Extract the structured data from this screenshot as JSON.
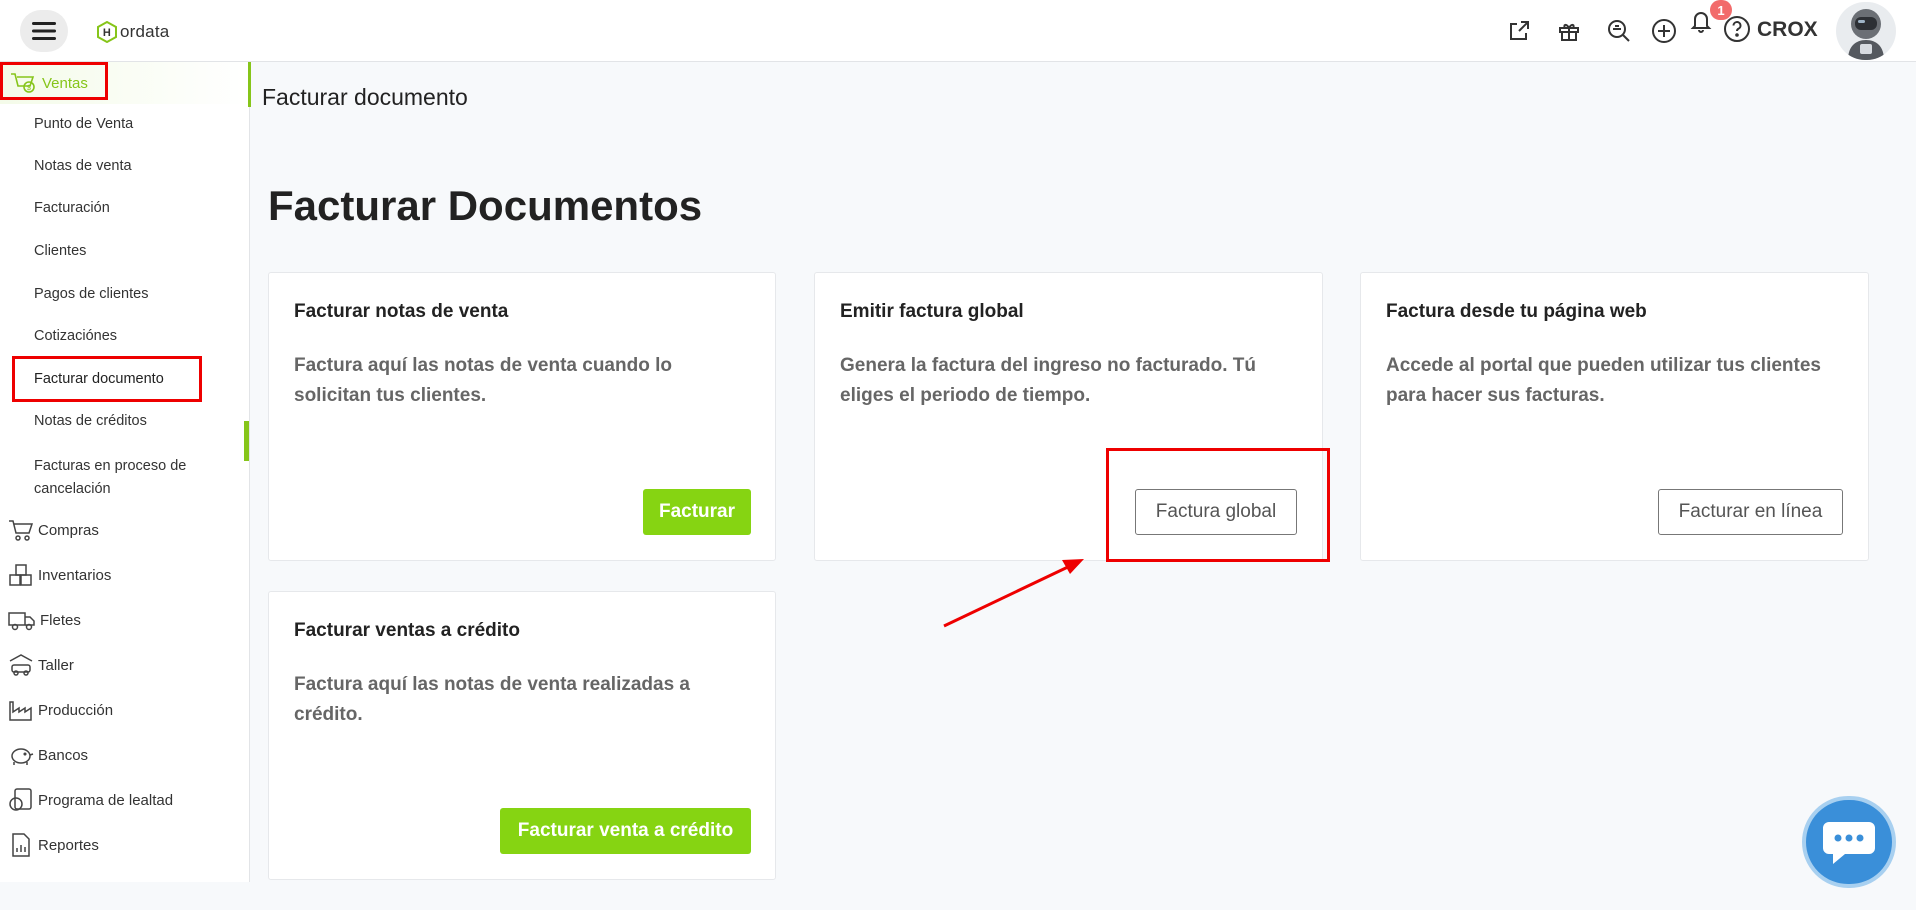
{
  "header": {
    "logo_text": "ordata",
    "notification_count": "1",
    "username": "CROX"
  },
  "sidebar": {
    "section": {
      "label": "Ventas"
    },
    "sub_items": [
      {
        "label": "Punto de Venta"
      },
      {
        "label": "Notas de venta"
      },
      {
        "label": "Facturación"
      },
      {
        "label": "Clientes"
      },
      {
        "label": "Pagos de clientes"
      },
      {
        "label": "Cotizaciónes"
      },
      {
        "label": "Facturar documento"
      },
      {
        "label": "Notas de créditos"
      },
      {
        "label": "Facturas en proceso de cancelación"
      }
    ],
    "main_items": [
      {
        "label": "Compras"
      },
      {
        "label": "Inventarios"
      },
      {
        "label": "Fletes"
      },
      {
        "label": "Taller"
      },
      {
        "label": "Producción"
      },
      {
        "label": "Bancos"
      },
      {
        "label": "Programa de lealtad"
      },
      {
        "label": "Reportes"
      }
    ]
  },
  "main": {
    "breadcrumb": "Facturar documento",
    "title": "Facturar Documentos",
    "cards": [
      {
        "title": "Facturar notas de venta",
        "description": "Factura aquí las notas de venta cuando lo solicitan tus clientes.",
        "button": "Facturar"
      },
      {
        "title": "Emitir factura global",
        "description": "Genera la factura del ingreso no facturado. Tú eliges el periodo de tiempo.",
        "button": "Factura global"
      },
      {
        "title": "Factura desde tu página web",
        "description": "Accede al portal que pueden utilizar tus clientes para hacer sus facturas.",
        "button": "Facturar en línea"
      },
      {
        "title": "Facturar ventas a crédito",
        "description": "Factura aquí las notas de venta realizadas a crédito.",
        "button": "Facturar venta a crédito"
      }
    ]
  },
  "colors": {
    "accent_green": "#86d412",
    "highlight_red": "#ee0000",
    "chat_blue": "#3a8fd9"
  }
}
